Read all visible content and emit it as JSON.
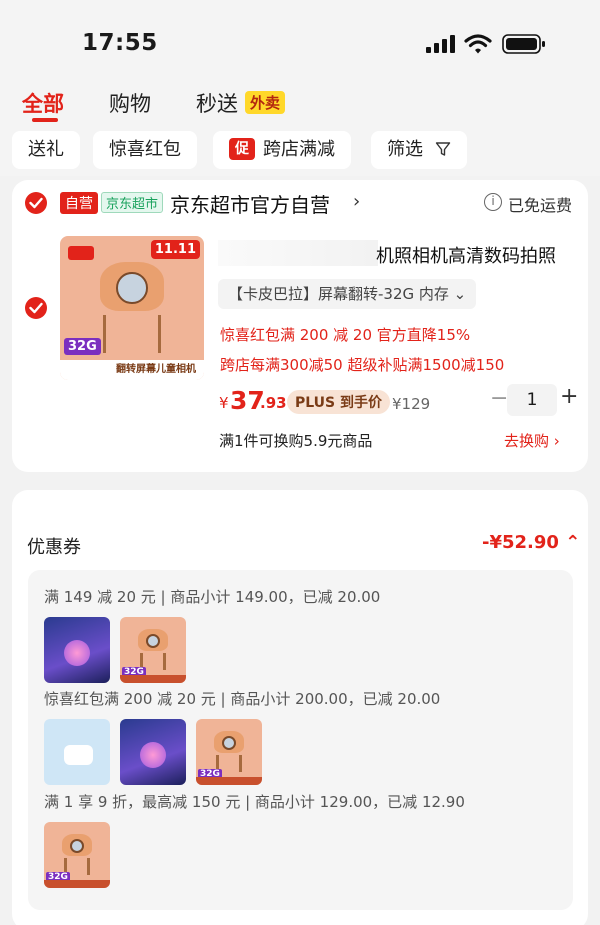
{
  "status": {
    "time": "17:55"
  },
  "tabs": [
    {
      "label": "全部"
    },
    {
      "label": "购物"
    },
    {
      "label": "秒送"
    }
  ],
  "tab_badge": "外卖",
  "filters": {
    "gift": "送礼",
    "redpacket": "惊喜红包",
    "cross_store_tag": "促",
    "cross_store": "跨店满减",
    "filter": "筛选"
  },
  "store": {
    "self_tag": "自营",
    "super_tag": "京东超市",
    "name": "京东超市官方自营",
    "arrow": "›",
    "free_shipping": "已免运费"
  },
  "product": {
    "title": "机照相机高清数码拍照",
    "spec": "【卡皮巴拉】屏幕翻转-32G 内存 ⌄",
    "promos": [
      "惊喜红包满 200 减 20   官方直降15%",
      "跨店每满300减50   超级补贴满1500减150"
    ],
    "currency": "¥",
    "price_int": "37",
    "price_dec": ".93",
    "plus_label": "PLUS 到手价",
    "orig_price": "¥129",
    "qty_minus": "−",
    "quantity": "1",
    "qty_plus": "+",
    "swap_text": "满1件可换购5.9元商品",
    "swap_link": "去换购 ›",
    "img_tags": {
      "sale": "11.11",
      "storage": "32G",
      "caption": "翻转屏幕儿童相机"
    }
  },
  "coupon": {
    "title": "优惠券",
    "total": "-¥52.90 ⌃",
    "rules": [
      "满 149 减 20 元 | 商品小计 149.00，已减 20.00",
      "惊喜红包满 200 减 20 元 | 商品小计 200.00，已减 20.00",
      "满 1 享 9 折，最高减 150 元 | 商品小计 129.00，已减 12.90"
    ]
  },
  "colors": {
    "accent": "#e2231a",
    "background": "#f2f2f2"
  }
}
